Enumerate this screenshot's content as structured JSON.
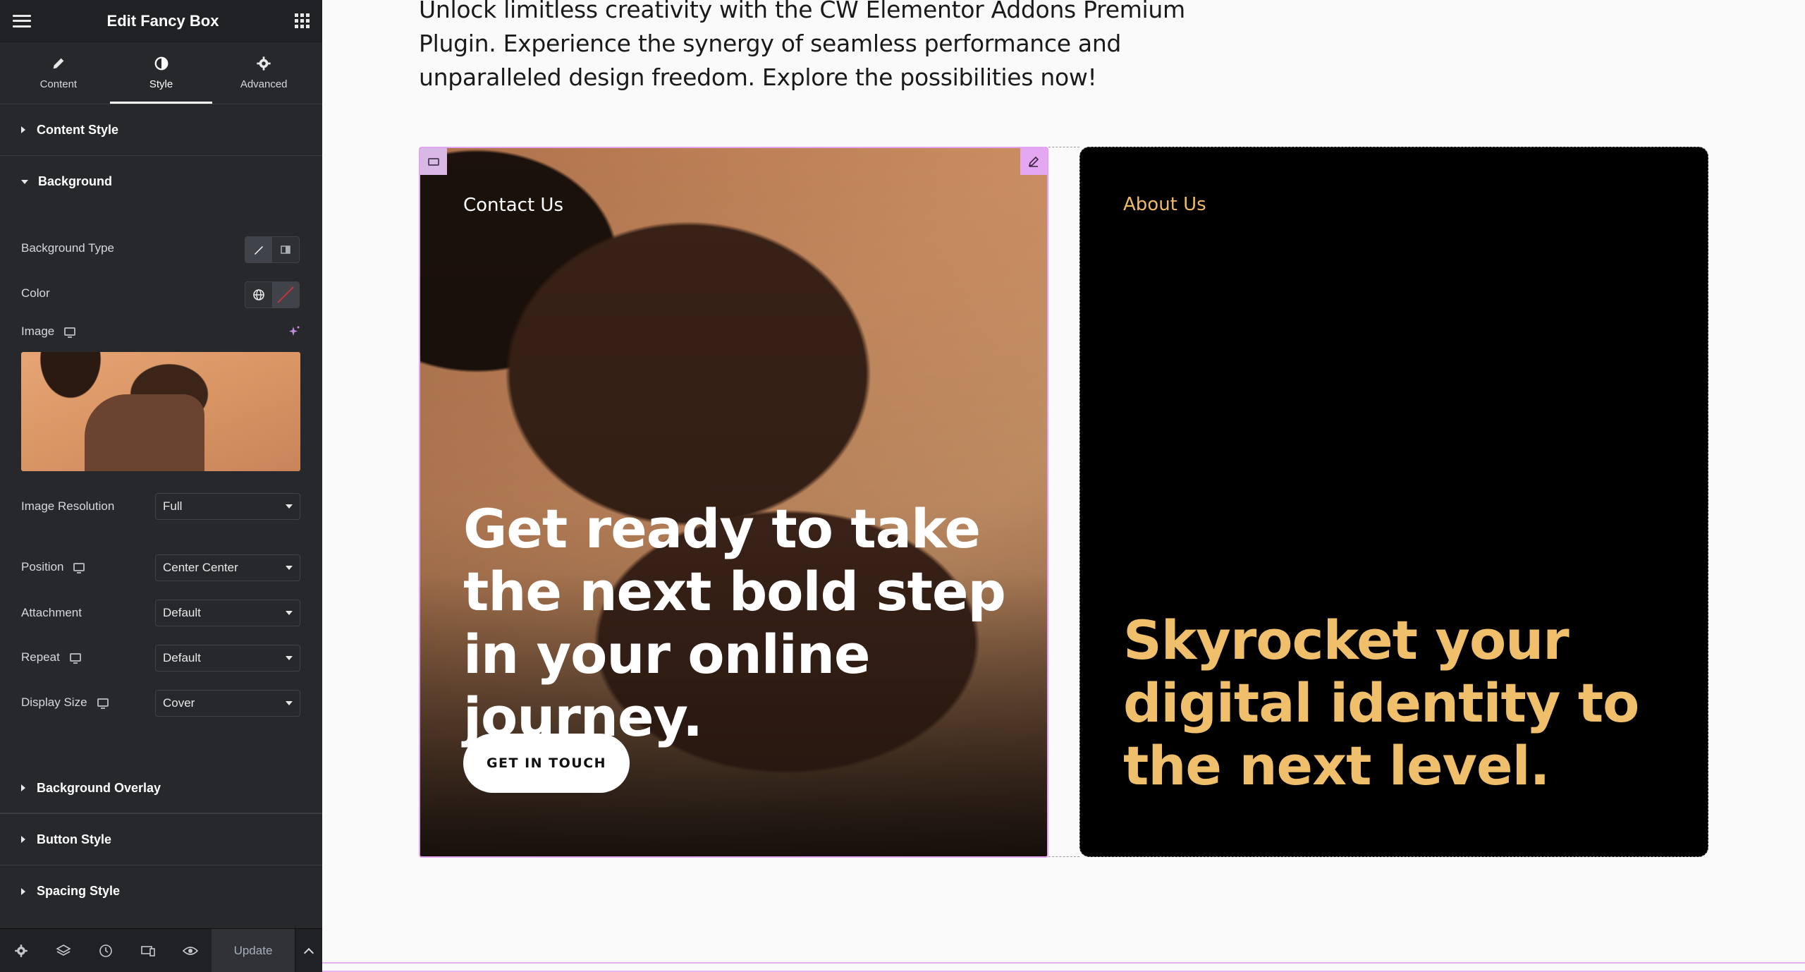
{
  "panel": {
    "title": "Edit Fancy Box",
    "tabs": [
      {
        "label": "Content",
        "icon": "pencil-icon"
      },
      {
        "label": "Style",
        "icon": "contrast-icon"
      },
      {
        "label": "Advanced",
        "icon": "gear-icon"
      }
    ],
    "sections": {
      "content_style": "Content Style",
      "background": "Background",
      "background_overlay": "Background Overlay",
      "button_style": "Button Style",
      "spacing_style": "Spacing Style"
    },
    "background": {
      "type_label": "Background Type",
      "color_label": "Color",
      "image_label": "Image",
      "image_resolution_label": "Image Resolution",
      "image_resolution_value": "Full",
      "position_label": "Position",
      "position_value": "Center Center",
      "attachment_label": "Attachment",
      "attachment_value": "Default",
      "repeat_label": "Repeat",
      "repeat_value": "Default",
      "display_size_label": "Display Size",
      "display_size_value": "Cover"
    },
    "footer": {
      "update_label": "Update"
    }
  },
  "canvas": {
    "intro_text": "Unlock limitless creativity with the CW Elementor Addons Premium Plugin. Experience the synergy of seamless performance and unparalleled design freedom. Explore the possibilities now!",
    "contact_card": {
      "label": "Contact Us",
      "heading": "Get ready to take the next bold step in your online journey.",
      "button": "GET IN TOUCH"
    },
    "about_card": {
      "label": "About Us",
      "heading": "Skyrocket your digital identity to the next level."
    }
  },
  "colors": {
    "panel_bg": "#26282b",
    "accent_gold": "#f0bf6b",
    "selection_pink": "#e2a6f0"
  }
}
